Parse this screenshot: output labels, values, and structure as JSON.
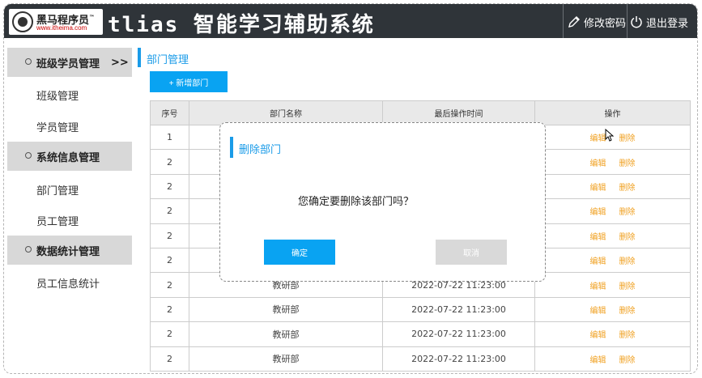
{
  "header": {
    "logo_text": "黑马程序员",
    "logo_tm": "™",
    "logo_url": "www.itheima.com",
    "app_title": "tlias 智能学习辅助系统",
    "change_password": "修改密码",
    "logout": "退出登录",
    "bg_color": "#2f3439"
  },
  "sidebar": {
    "groups": [
      {
        "label": "班级学员管理",
        "arrow": ">>"
      },
      {
        "label": "系统信息管理"
      },
      {
        "label": "数据统计管理"
      }
    ],
    "items": [
      "班级管理",
      "学员管理",
      "部门管理",
      "员工管理",
      "员工信息统计"
    ]
  },
  "main": {
    "breadcrumb": "部门管理",
    "add_button": "+ 新增部门",
    "accent_color": "#1a9be8",
    "table": {
      "headers": [
        "序号",
        "部门名称",
        "最后操作时间",
        "操作"
      ],
      "rows": [
        {
          "no": "1",
          "name": "",
          "time": ""
        },
        {
          "no": "2",
          "name": "",
          "time": ""
        },
        {
          "no": "2",
          "name": "",
          "time": ""
        },
        {
          "no": "2",
          "name": "",
          "time": ""
        },
        {
          "no": "2",
          "name": "",
          "time": ""
        },
        {
          "no": "2",
          "name": "",
          "time": ""
        },
        {
          "no": "2",
          "name": "教研部",
          "time": "2022-07-22 11:23:00"
        },
        {
          "no": "2",
          "name": "教研部",
          "time": "2022-07-22 11:23:00"
        },
        {
          "no": "2",
          "name": "教研部",
          "time": "2022-07-22 11:23:00"
        },
        {
          "no": "2",
          "name": "教研部",
          "time": "2022-07-22 11:23:00"
        }
      ],
      "edit_label": "编辑",
      "delete_label": "删除",
      "link_color": "#f0a020"
    }
  },
  "dialog": {
    "title": "删除部门",
    "message": "您确定要删除该部门吗？",
    "ok": "确定",
    "cancel": "取消"
  }
}
